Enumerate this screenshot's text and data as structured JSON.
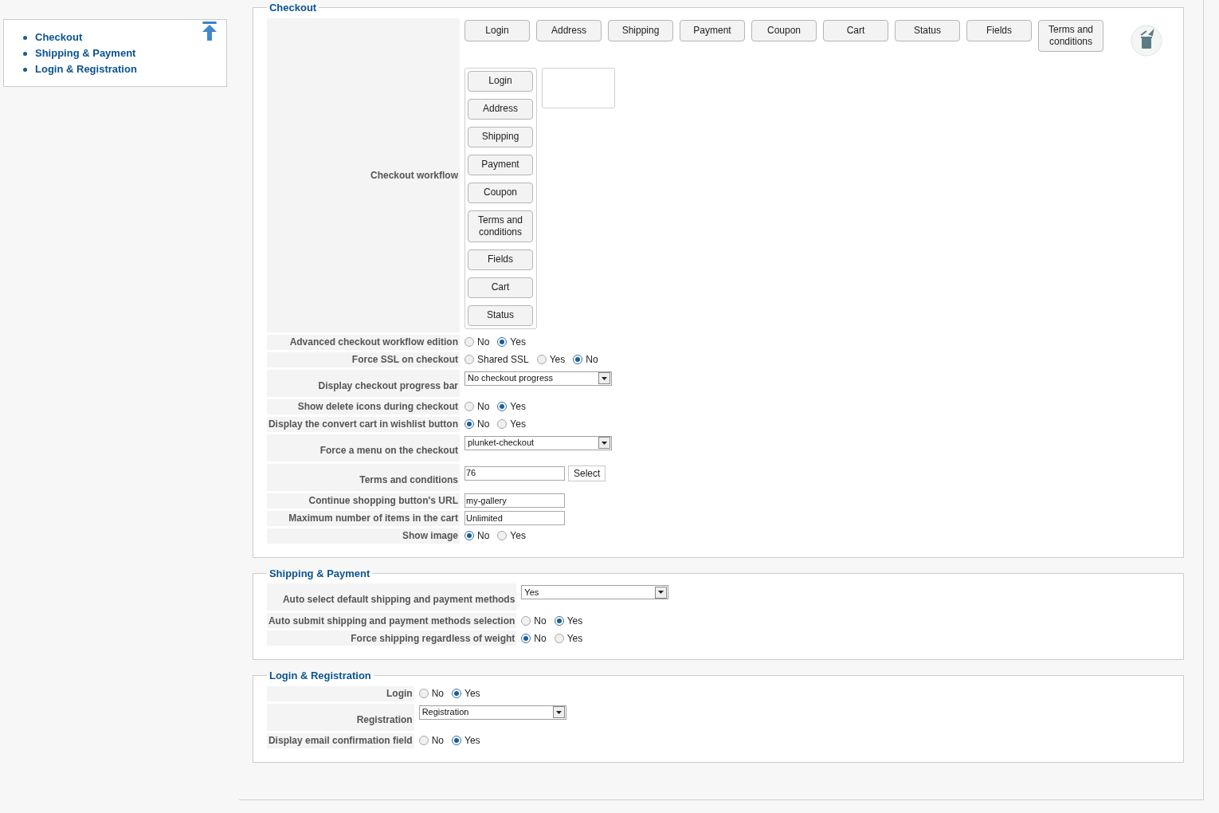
{
  "nav": {
    "items": [
      {
        "label": "Checkout"
      },
      {
        "label": "Shipping & Payment"
      },
      {
        "label": "Login & Registration"
      }
    ]
  },
  "sections": [
    {
      "legend": "Checkout",
      "workflow": {
        "label": "Checkout workflow",
        "available": [
          "Login",
          "Address",
          "Shipping",
          "Payment",
          "Coupon",
          "Cart",
          "Status",
          "Fields",
          "Terms and conditions"
        ],
        "sequence": [
          "Login",
          "Address",
          "Shipping",
          "Payment",
          "Coupon",
          "Terms and conditions",
          "Fields",
          "Cart",
          "Status"
        ]
      },
      "rows": [
        {
          "kind": "radio",
          "label": "Advanced checkout workflow edition",
          "options": [
            {
              "label": "No",
              "selected": false
            },
            {
              "label": "Yes",
              "selected": true
            }
          ]
        },
        {
          "kind": "radio",
          "label": "Force SSL on checkout",
          "options": [
            {
              "label": "Shared SSL",
              "selected": false
            },
            {
              "label": "Yes",
              "selected": false
            },
            {
              "label": "No",
              "selected": true
            }
          ]
        },
        {
          "kind": "select",
          "label": "Display checkout progress bar",
          "value": "No checkout progress"
        },
        {
          "kind": "radio",
          "label": "Show delete icons during checkout",
          "options": [
            {
              "label": "No",
              "selected": false
            },
            {
              "label": "Yes",
              "selected": true
            }
          ]
        },
        {
          "kind": "radio",
          "label": "Display the convert cart in wishlist button",
          "options": [
            {
              "label": "No",
              "selected": true
            },
            {
              "label": "Yes",
              "selected": false
            }
          ]
        },
        {
          "kind": "select",
          "label": "Force a menu on the checkout",
          "value": "plunket-checkout"
        },
        {
          "kind": "text",
          "label": "Terms and conditions",
          "value": "76",
          "button": "Select"
        },
        {
          "kind": "text",
          "label": "Continue shopping button's URL",
          "value": "my-gallery"
        },
        {
          "kind": "text",
          "label": "Maximum number of items in the cart",
          "value": "Unlimited"
        },
        {
          "kind": "radio",
          "label": "Show image",
          "options": [
            {
              "label": "No",
              "selected": true
            },
            {
              "label": "Yes",
              "selected": false
            }
          ]
        }
      ]
    },
    {
      "legend": "Shipping & Payment",
      "rows": [
        {
          "kind": "select",
          "label": "Auto select default shipping and payment methods",
          "value": "Yes"
        },
        {
          "kind": "radio",
          "label": "Auto submit shipping and payment methods selection",
          "options": [
            {
              "label": "No",
              "selected": false
            },
            {
              "label": "Yes",
              "selected": true
            }
          ]
        },
        {
          "kind": "radio",
          "label": "Force shipping regardless of weight",
          "options": [
            {
              "label": "No",
              "selected": true
            },
            {
              "label": "Yes",
              "selected": false
            }
          ]
        }
      ]
    },
    {
      "legend": "Login & Registration",
      "rows": [
        {
          "kind": "radio",
          "label": "Login",
          "options": [
            {
              "label": "No",
              "selected": false
            },
            {
              "label": "Yes",
              "selected": true
            }
          ]
        },
        {
          "kind": "select",
          "label": "Registration",
          "value": "Registration"
        },
        {
          "kind": "radio",
          "label": "Display email confirmation field",
          "options": [
            {
              "label": "No",
              "selected": false
            },
            {
              "label": "Yes",
              "selected": true
            }
          ]
        }
      ]
    }
  ]
}
